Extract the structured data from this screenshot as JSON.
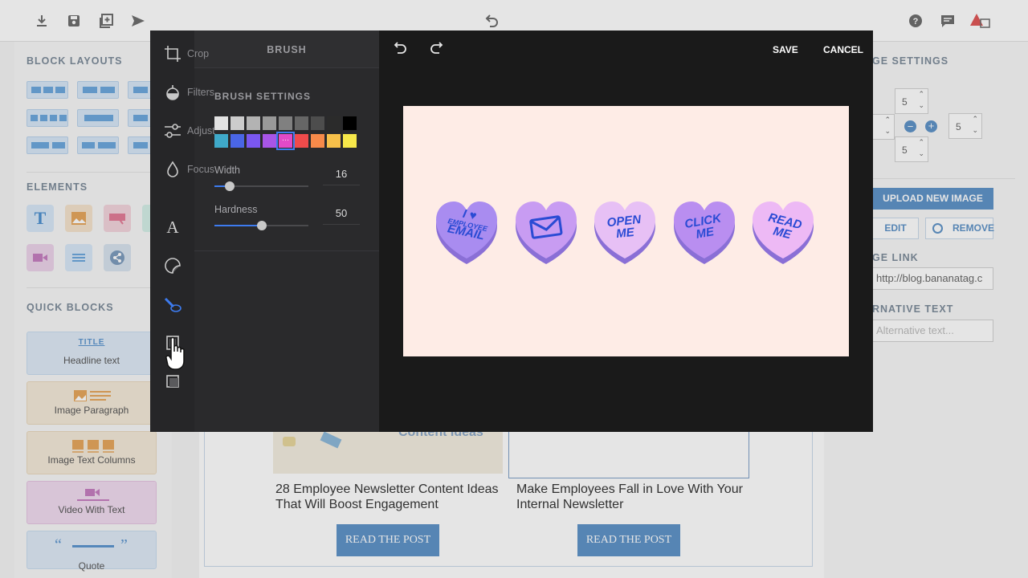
{
  "app": {
    "colors": {
      "accent": "#3d7bef",
      "modal_bg": "#1c1c1e",
      "image_bg": "#feece6",
      "heart_text": "#2a4bd4"
    }
  },
  "topbar": {
    "icons": [
      "download-icon",
      "save-icon",
      "add-icon",
      "send-icon",
      "undo-icon",
      "help-icon",
      "comment-icon",
      "warning-icon"
    ]
  },
  "left_panel": {
    "block_layouts_title": "BLOCK LAYOUTS",
    "elements_title": "ELEMENTS",
    "quick_blocks_title": "QUICK BLOCKS",
    "quick_blocks": [
      {
        "label": "Headline text",
        "badge": "TITLE"
      },
      {
        "label": "Image Paragraph"
      },
      {
        "label": "Image Text Columns"
      },
      {
        "label": "Video With Text"
      },
      {
        "label": "Quote"
      }
    ]
  },
  "canvas": {
    "partial_heading": "Content Ideas",
    "articles": [
      {
        "title": "28 Employee Newsletter Content Ideas That Will Boost Engagement",
        "button": "READ THE POST"
      },
      {
        "title": "Make Employees Fall in Love With Your Internal Newsletter",
        "button": "READ THE POST"
      }
    ]
  },
  "right_panel": {
    "settings_title": "GE SETTINGS",
    "padding": {
      "top": "5",
      "right": "5",
      "bottom": "5"
    },
    "upload_button": "UPLOAD NEW IMAGE",
    "edit_button": "EDIT",
    "remove_button": "REMOVE",
    "link_label": "GE LINK",
    "link_value": "http://blog.bananatag.c",
    "alt_label": "RNATIVE TEXT",
    "alt_placeholder": "Alternative text..."
  },
  "editor": {
    "panel_title": "BRUSH",
    "section_title": "BRUSH SETTINGS",
    "save_label": "SAVE",
    "cancel_label": "CANCEL",
    "tools": [
      {
        "name": "crop",
        "label": "Crop",
        "icon": "crop-icon"
      },
      {
        "name": "filters",
        "label": "Filters",
        "icon": "filters-icon"
      },
      {
        "name": "adjust",
        "label": "Adjust",
        "icon": "adjust-icon"
      },
      {
        "name": "focus",
        "label": "Focus",
        "icon": "focus-icon"
      }
    ],
    "colors_row1": [
      "#e2e2e2",
      "#cccccc",
      "#b3b3b3",
      "#999999",
      "#808080",
      "#666666",
      "#4d4d4d",
      "#2b2b2b",
      "#000000"
    ],
    "colors_row2": [
      "#3fa9c9",
      "#4a66e6",
      "#7a57f0",
      "#a855e8",
      "#e24ac8",
      "#ef4b4b",
      "#f78a4a",
      "#f7c04a",
      "#f7e84a"
    ],
    "width": {
      "label": "Width",
      "value": "16",
      "level": 0.16
    },
    "hardness": {
      "label": "Hardness",
      "value": "50",
      "level": 0.5
    },
    "image": {
      "hearts": [
        {
          "lines": [
            "I ♥",
            "EMPLOYEE",
            "EMAIL"
          ],
          "color": "#a98cf0"
        },
        {
          "lines": [
            "✉"
          ],
          "color": "#c89cf2"
        },
        {
          "lines": [
            "OPEN",
            "ME"
          ],
          "color": "#e7c0f5"
        },
        {
          "lines": [
            "CLICK",
            "ME"
          ],
          "color": "#b98ef0"
        },
        {
          "lines": [
            "READ",
            "ME"
          ],
          "color": "#edb9f5"
        }
      ]
    }
  }
}
